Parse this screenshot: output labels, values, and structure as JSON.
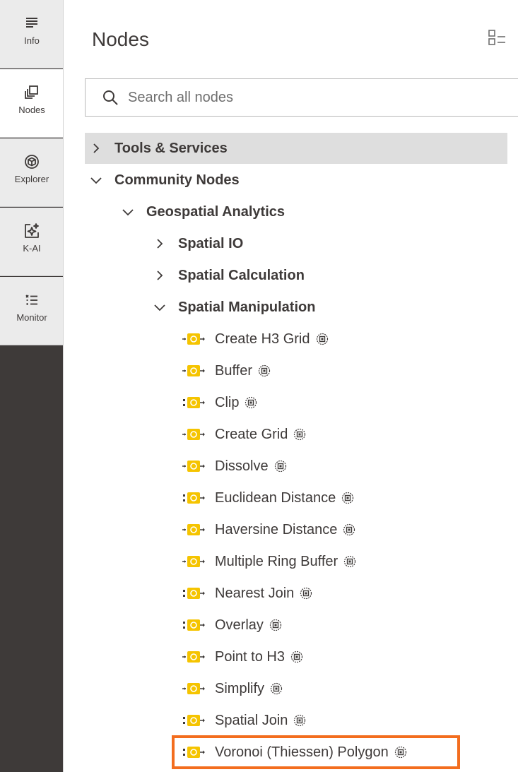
{
  "sidebar": {
    "items": [
      {
        "label": "Info",
        "icon": "info-lines-icon",
        "active": false
      },
      {
        "label": "Nodes",
        "icon": "nodes-stack-icon",
        "active": true
      },
      {
        "label": "Explorer",
        "icon": "cube-icon",
        "active": false
      },
      {
        "label": "K-AI",
        "icon": "ai-sparkle-icon",
        "active": false
      },
      {
        "label": "Monitor",
        "icon": "monitor-list-icon",
        "active": false
      }
    ]
  },
  "panel": {
    "title": "Nodes",
    "menu_icon": "list-view-icon",
    "search": {
      "placeholder": "Search all nodes",
      "value": ""
    }
  },
  "tree": {
    "tools_services": "Tools & Services",
    "community_nodes": "Community Nodes",
    "geospatial_analytics": "Geospatial Analytics",
    "spatial_io": "Spatial IO",
    "spatial_calculation": "Spatial Calculation",
    "spatial_manipulation": "Spatial Manipulation",
    "nodes": [
      {
        "label": "Create H3 Grid"
      },
      {
        "label": "Buffer"
      },
      {
        "label": "Clip"
      },
      {
        "label": "Create Grid"
      },
      {
        "label": "Dissolve"
      },
      {
        "label": "Euclidean Distance"
      },
      {
        "label": "Haversine Distance"
      },
      {
        "label": "Multiple Ring Buffer"
      },
      {
        "label": "Nearest Join"
      },
      {
        "label": "Overlay"
      },
      {
        "label": "Point to H3"
      },
      {
        "label": "Simplify"
      },
      {
        "label": "Spatial Join"
      },
      {
        "label": "Voronoi (Thiessen) Polygon"
      }
    ],
    "selected_node": "Voronoi (Thiessen) Polygon"
  },
  "colors": {
    "rail_dark": "#3e3a39",
    "node_icon_yellow": "#f5c400",
    "selection_orange": "#f36d1e",
    "row_highlight": "#dedede"
  }
}
